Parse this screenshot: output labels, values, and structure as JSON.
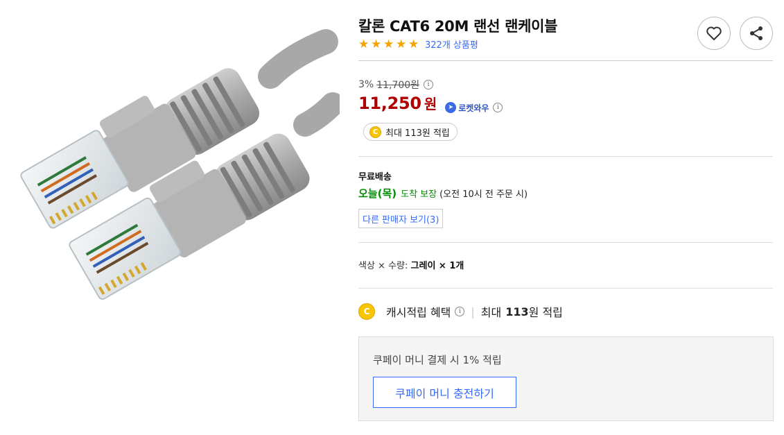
{
  "product": {
    "title": "칼론 CAT6 20M 랜선 랜케이블",
    "rating_stars": 5,
    "review_link": "322개 상품평"
  },
  "icons": {
    "wish": "heart-icon",
    "share": "share-icon",
    "info": "info-icon",
    "rocket": "rocket-icon",
    "coin": "coin-icon"
  },
  "pricing": {
    "discount_rate": "3%",
    "original_price": "11,700원",
    "sale_price": "11,250",
    "currency": "원",
    "rocket_label": "로켓와우",
    "info_glyph": "i"
  },
  "cash_pill": {
    "coin_glyph": "C",
    "text": "최대 113원 적립"
  },
  "shipping": {
    "title": "무료배송",
    "day": "오늘(목)",
    "guarantee": "도착 보장",
    "note": "(오전 10시 전 주문 시)",
    "other_sellers": "다른 판매자 보기(3)"
  },
  "option": {
    "label": "색상 × 수량:",
    "value": "그레이 × 1개"
  },
  "cash_benefit": {
    "coin_glyph": "C",
    "label": "캐시적립 혜택",
    "separator": "|",
    "max_prefix": "최대",
    "max_amount": "113",
    "max_suffix": "원 적립"
  },
  "coupay": {
    "text": "쿠페이 머니 결제 시 1% 적립",
    "button": "쿠페이 머니 충전하기"
  },
  "colors": {
    "price_red": "#ae0000",
    "link_blue": "#346aff",
    "delivery_green": "#008c00",
    "star_orange": "#f5a300",
    "coin_yellow": "#f7c600"
  }
}
